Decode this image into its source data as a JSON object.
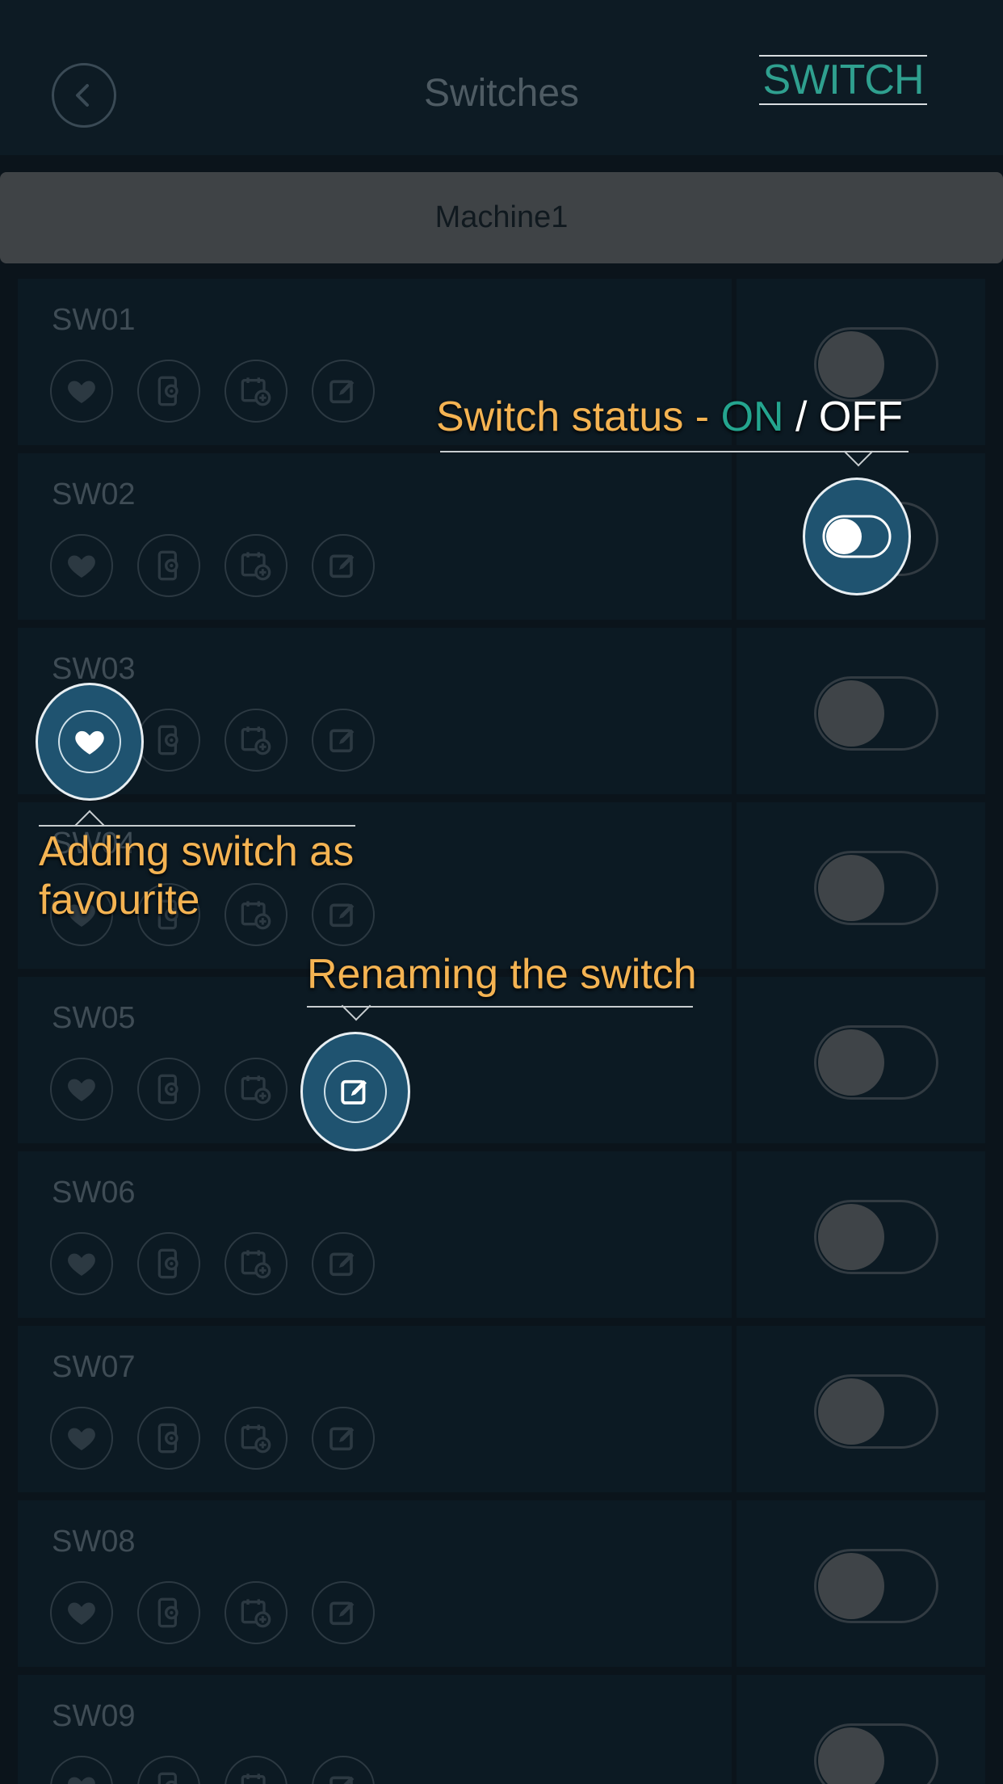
{
  "header": {
    "title": "Switches",
    "switch_link": "SWITCH"
  },
  "machine_tab": "Machine1",
  "rows": [
    {
      "name": "SW01"
    },
    {
      "name": "SW02"
    },
    {
      "name": "SW03"
    },
    {
      "name": "SW04"
    },
    {
      "name": "SW05"
    },
    {
      "name": "SW06"
    },
    {
      "name": "SW07"
    },
    {
      "name": "SW08"
    },
    {
      "name": "SW09"
    }
  ],
  "callouts": {
    "status": {
      "prefix": "Switch status - ",
      "on": "ON",
      "sep": " / ",
      "off": "OFF"
    },
    "favourite": {
      "line1": "Adding switch as",
      "line2": "favourite"
    },
    "rename": "Renaming the switch"
  },
  "icons": [
    "heart-icon",
    "mobile-settings-icon",
    "calendar-add-icon",
    "edit-icon"
  ],
  "colors": {
    "accent_teal": "#2fa08f",
    "caption_orange": "#f4b352",
    "highlight_blue": "#1f5370"
  }
}
